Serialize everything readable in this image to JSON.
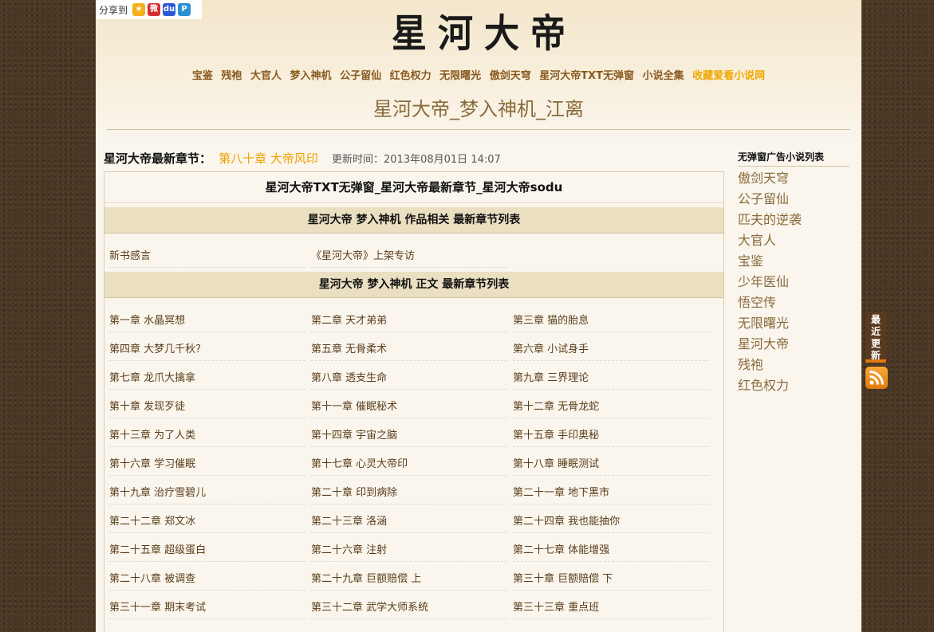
{
  "share": {
    "label": "分享到",
    "icons": [
      {
        "name": "qzone-icon",
        "color": "#f2b21b",
        "glyph": "★"
      },
      {
        "name": "weibo-icon",
        "color": "#d62e2e",
        "glyph": "微"
      },
      {
        "name": "baidu-icon",
        "color": "#2a58d6",
        "glyph": "du"
      },
      {
        "name": "pengyou-icon",
        "color": "#2b8fd2",
        "glyph": "P"
      }
    ]
  },
  "logo": [
    "星",
    "河",
    "大",
    "帝"
  ],
  "nav": [
    {
      "label": "宝鉴"
    },
    {
      "label": "残袍"
    },
    {
      "label": "大官人"
    },
    {
      "label": "梦入神机"
    },
    {
      "label": "公子留仙"
    },
    {
      "label": "红色权力"
    },
    {
      "label": "无限曙光"
    },
    {
      "label": "傲剑天穹"
    },
    {
      "label": "星河大帝TXT无弹窗"
    },
    {
      "label": "小说全集"
    },
    {
      "label": "收藏爱看小说网",
      "highlight": true
    }
  ],
  "page_title": "星河大帝_梦入神机_江离",
  "latest": {
    "label": "星河大帝最新章节：",
    "chapter": "第八十章 大帝风印",
    "update_label": "更新时间：",
    "update_time": "2013年08月01日 14:07"
  },
  "main_title": "星河大帝TXT无弹窗_星河大帝最新章节_星河大帝sodu",
  "sections": {
    "related_title": "星河大帝 梦入神机 作品相关 最新章节列表",
    "related": [
      "新书感言",
      "《星河大帝》上架专访"
    ],
    "body_title": "星河大帝 梦入神机 正文 最新章节列表"
  },
  "chapters": [
    "第一章 水晶冥想",
    "第二章 天才弟弟",
    "第三章 猫的胎息",
    "第四章 大梦几千秋？",
    "第五章 无骨柔术",
    "第六章 小试身手",
    "第七章 龙爪大擒拿",
    "第八章 透支生命",
    "第九章 三界理论",
    "第十章 发现歹徒",
    "第十一章 催眠秘术",
    "第十二章 无骨龙蛇",
    "第十三章 为了人类",
    "第十四章 宇宙之脑",
    "第十五章 手印奥秘",
    "第十六章 学习催眠",
    "第十七章 心灵大帝印",
    "第十八章 睡眠测试",
    "第十九章 治疗雪碧儿",
    "第二十章 印到病除",
    "第二十一章 地下黑市",
    "第二十二章 郑文冰",
    "第二十三章 洛涵",
    "第二十四章 我也能抽你",
    "第二十五章 超级蛋白",
    "第二十六章 注射",
    "第二十七章 体能增强",
    "第二十八章 被调查",
    "第二十九章 巨额赔偿 上",
    "第三十章 巨额赔偿 下",
    "第三十一章 期末考试",
    "第三十二章 武学大师系统",
    "第三十三章 重点班"
  ],
  "sidebar": {
    "title": "无弹窗广告小说列表",
    "items": [
      "傲剑天穹",
      "公子留仙",
      "匹夫的逆袭",
      "大官人",
      "宝鉴",
      "少年医仙",
      "悟空传",
      "无限曙光",
      "星河大帝",
      "残袍",
      "红色权力"
    ]
  },
  "float": {
    "recent_label": "最近更新",
    "rss_icon": "rss-icon"
  }
}
